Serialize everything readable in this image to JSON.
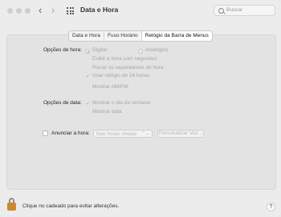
{
  "window": {
    "title": "Data e Hora",
    "back": "‹",
    "forward": "›"
  },
  "search": {
    "placeholder": "Buscar"
  },
  "tabs": [
    {
      "label": "Data e Hora"
    },
    {
      "label": "Fuso Horário"
    },
    {
      "label": "Relógio da Barra de Menus",
      "selected": true
    }
  ],
  "time_options": {
    "label": "Opções de hora:",
    "digital": "Digital",
    "analog": "Analógico",
    "show_seconds": "Exibir a hora com segundos",
    "flash_separators": "Piscar os separadores de hora",
    "use_24h": "Usar relógio de 24 horas",
    "show_ampm": "Mostrar AM/PM"
  },
  "date_options": {
    "label": "Opções de data:",
    "show_weekday": "Mostrar o dia da semana",
    "show_date": "Mostrar data"
  },
  "announce": {
    "label": "Anunciar a hora:",
    "select_value": "Nas horas cheias",
    "customize_button": "Personalizar Voz..."
  },
  "footer": {
    "lock_text": "Clique no cadeado para evitar alterações.",
    "help": "?"
  },
  "colors": {
    "lock": "#c98a32",
    "disabled_text": "#a6a6a6"
  }
}
